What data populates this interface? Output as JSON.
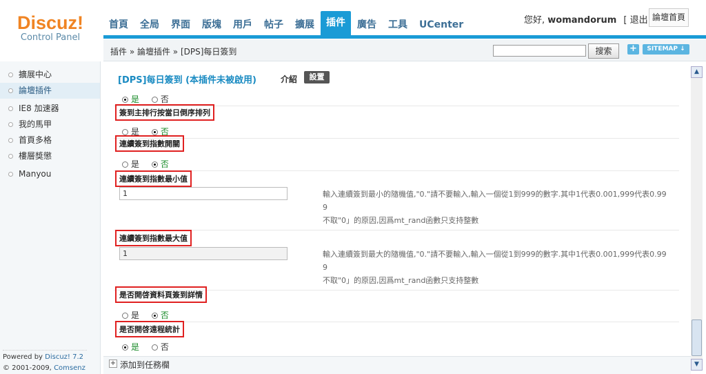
{
  "logo": {
    "name": "Discuz!",
    "sub": "Control Panel"
  },
  "nav": {
    "tabs": [
      "首頁",
      "全局",
      "界面",
      "版塊",
      "用戶",
      "帖子",
      "擴展",
      "插件",
      "廣告",
      "工具",
      "UCenter"
    ],
    "active": "插件"
  },
  "user": {
    "greeting": "您好,",
    "name": "womandorum",
    "logout": "[ 退出 ]",
    "home": "論壇首頁"
  },
  "breadcrumb": "插件 » 論壇插件 » [DPS]每日簽到",
  "search": {
    "button": "搜索",
    "value": ""
  },
  "sitemap": {
    "plus": "+",
    "label": "SITEMAP ↓"
  },
  "sidebar": {
    "items": [
      {
        "label": "擴展中心",
        "active": false
      },
      {
        "label": "論壇插件",
        "active": true
      },
      {
        "label": "IE8 加速器",
        "active": false
      },
      {
        "label": "我的馬甲",
        "active": false
      },
      {
        "label": "首頁多格",
        "active": false
      },
      {
        "label": "樓層獎懲",
        "active": false
      },
      {
        "label": "Manyou",
        "active": false
      }
    ],
    "powered_prefix": "Powered by",
    "powered_link": "Discuz! 7.2",
    "copyright_prefix": "© 2001-2009,",
    "copyright_link": "Comsenz Inc."
  },
  "main": {
    "title": "[DPS]每日簽到 (本插件未被啟用)",
    "intro": "介紹",
    "setting": "設置",
    "yes": "是",
    "no": "否",
    "settings": [
      {
        "label": "簽到主排行按當日倒序排列",
        "type": "radio",
        "value": "是"
      },
      {
        "label": "連續簽到指數開關",
        "type": "radio",
        "value": "否"
      },
      {
        "label": "連續簽到指數最小值",
        "type": "text",
        "value": "1",
        "note1": "輸入連續簽到最小的隨機值,\"0.\"請不要輸入,輸入一個從1到999的數字.其中1代表0.001,999代表0.99",
        "note2": "9",
        "note3": "不取\"0」的原因,因爲mt_rand函數只支持整數"
      },
      {
        "label": "連續簽到指數最大值",
        "type": "text",
        "value": "1",
        "note1": "輸入連續簽到最大的隨機值,\"0.\"請不要輸入,輸入一個從1到999的數字.其中1代表0.001,999代表0.99",
        "note2": "9",
        "note3": "不取\"0」的原因,因爲mt_rand函數只支持整數"
      },
      {
        "label": "是否開啓資料頁簽到詳情",
        "type": "radio",
        "value": "否"
      },
      {
        "label": "是否開啓遠程統計",
        "type": "radio",
        "value": "是"
      }
    ],
    "top_radio_value": "是"
  },
  "footer": {
    "icon": "+",
    "label": "添加到任務欄"
  },
  "colors": {
    "accent": "#1a9bd6",
    "logo": "#f08423",
    "highlight": "#e02020"
  }
}
